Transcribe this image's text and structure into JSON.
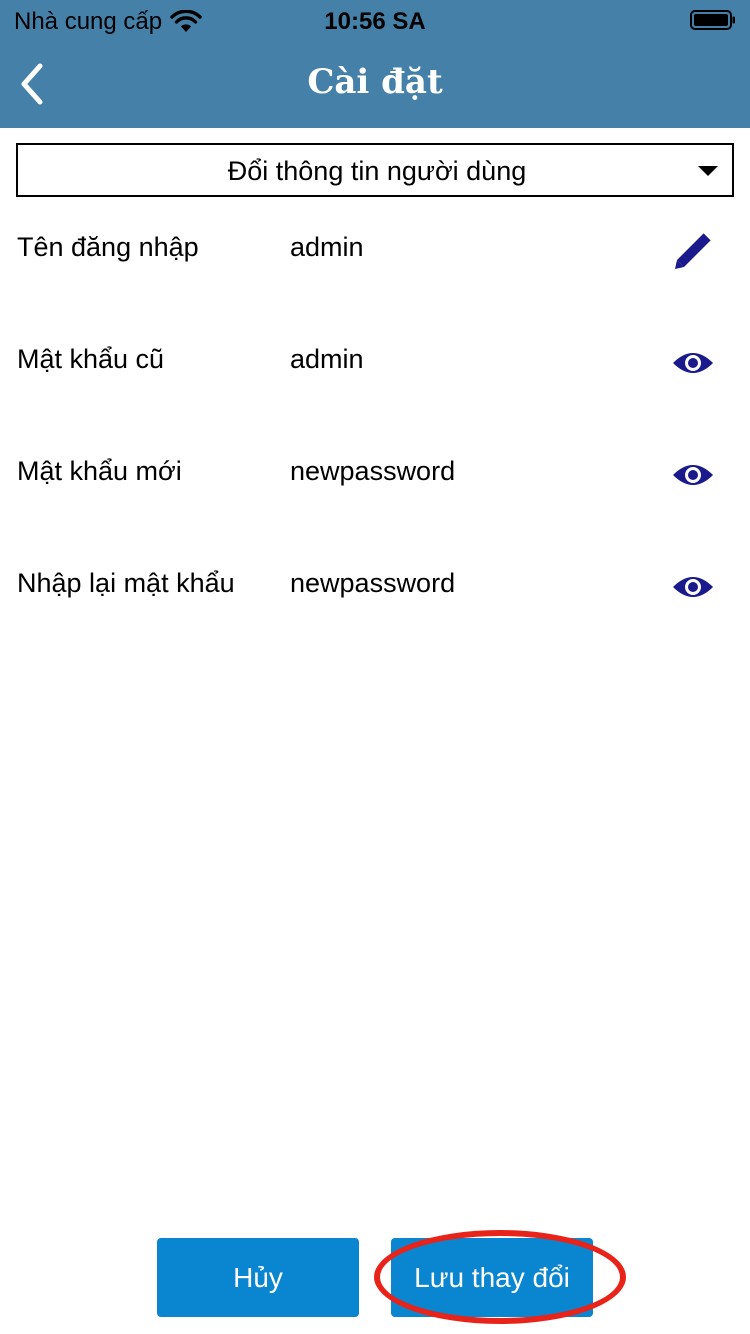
{
  "status_bar": {
    "carrier": "Nhà cung cấp",
    "time": "10:56 SA"
  },
  "nav": {
    "title": "Cài đặt",
    "back_icon": "chevron-left-icon"
  },
  "dropdown": {
    "selected": "Đổi thông tin người dùng"
  },
  "fields": [
    {
      "label": "Tên đăng nhập",
      "value": "admin",
      "icon": "pencil-icon"
    },
    {
      "label": "Mật khẩu cũ",
      "value": "admin",
      "icon": "eye-icon"
    },
    {
      "label": "Mật khẩu mới",
      "value": "newpassword",
      "icon": "eye-icon"
    },
    {
      "label": "Nhập lại mật khẩu",
      "value": "newpassword",
      "icon": "eye-icon"
    }
  ],
  "buttons": {
    "cancel_label": "Hủy",
    "save_label": "Lưu thay đổi"
  },
  "colors": {
    "header": "#4580a8",
    "button": "#0a85d0",
    "icon": "#1a1a8c",
    "highlight": "#e8231a"
  }
}
